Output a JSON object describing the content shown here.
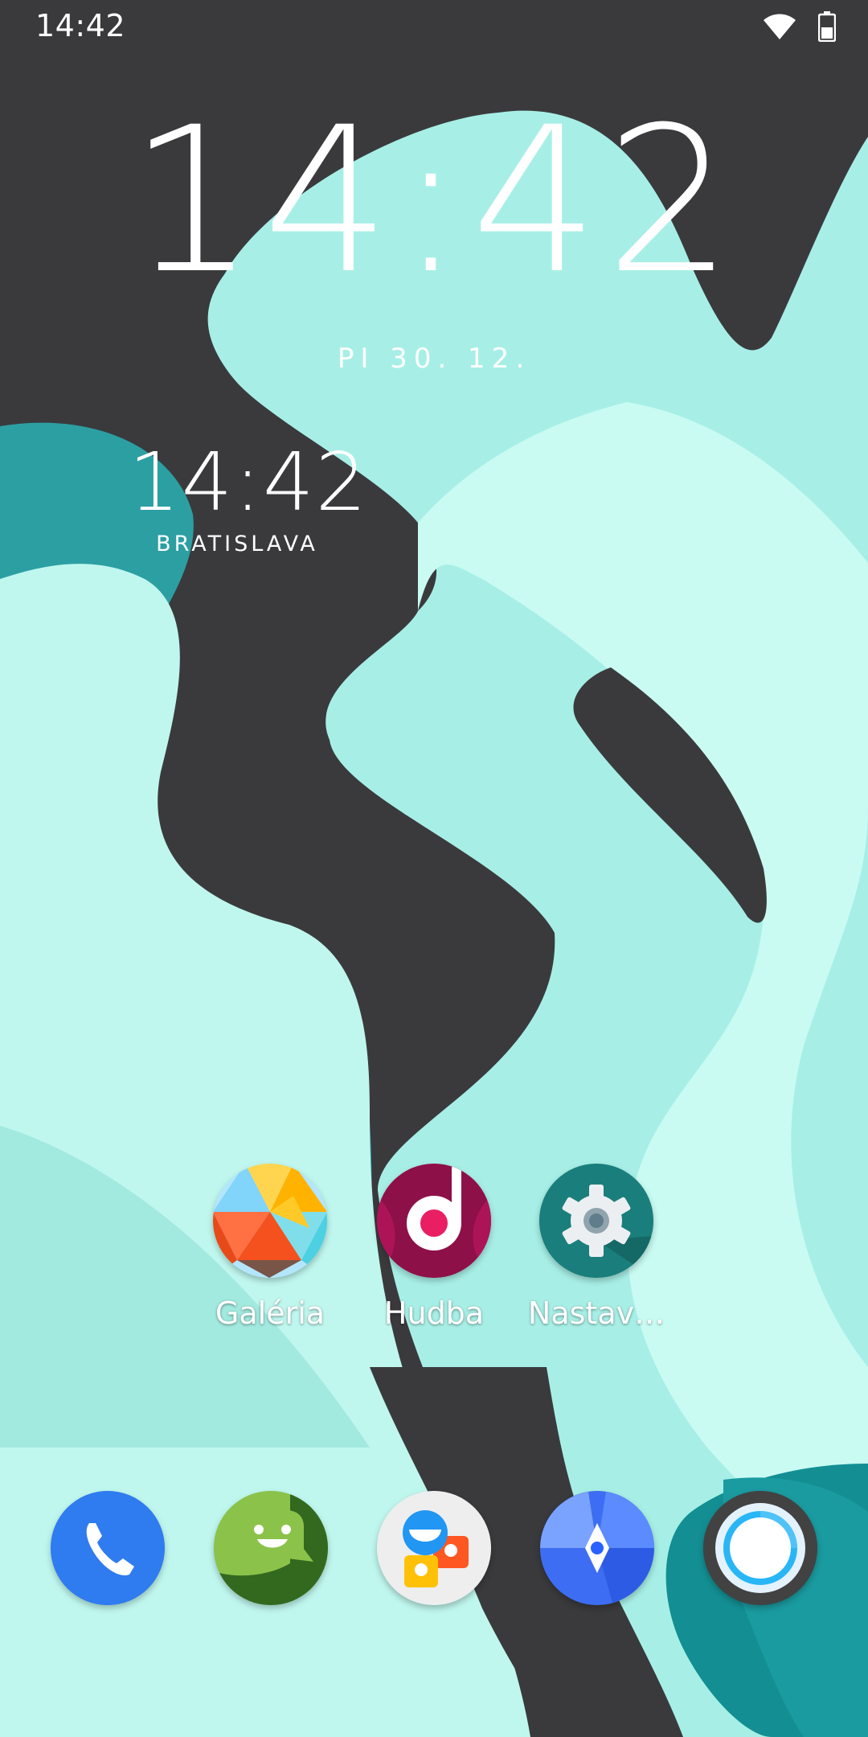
{
  "status_bar": {
    "time": "14:42",
    "icons": [
      "wifi-icon",
      "battery-icon"
    ]
  },
  "clock_widget": {
    "time": "14:42",
    "date": "PI 30. 12."
  },
  "world_clock": {
    "time": "14:42",
    "city": "BRATISLAVA"
  },
  "home_apps": [
    {
      "label": "Galéria",
      "icon": "gallery-icon"
    },
    {
      "label": "Hudba",
      "icon": "music-icon"
    },
    {
      "label": "Nastav…",
      "icon": "settings-icon"
    }
  ],
  "dock": [
    {
      "icon": "phone-icon"
    },
    {
      "icon": "messages-icon"
    },
    {
      "icon": "contacts-icon"
    },
    {
      "icon": "browser-icon"
    },
    {
      "icon": "camera-icon"
    }
  ],
  "colors": {
    "wallpaper_dark": "#3a3a3c",
    "wallpaper_mint": "#b8f5ec",
    "wallpaper_teal": "#1e9aa0"
  }
}
